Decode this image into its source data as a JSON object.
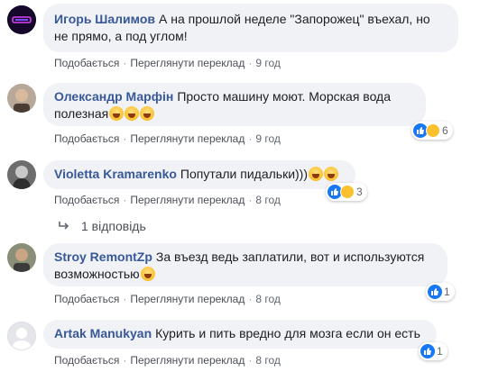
{
  "comments": [
    {
      "author": "Игорь Шалимов",
      "text_line1": "А на прошлой неделе \"Запорожец\" въехал, но",
      "text_line2": "не прямо, а под углом!",
      "like_label": "Подобається",
      "translate_label": "Переглянути переклад",
      "time": "9 год",
      "avatar_icon": "avatar-neon-logo"
    },
    {
      "author": "Олександр Марфін",
      "text_line1": "Просто машину моют. Морская вода",
      "text_line2": "полезная",
      "like_label": "Подобається",
      "translate_label": "Переглянути переклад",
      "time": "9 год",
      "reaction_count": "6",
      "avatar_icon": "avatar-man-photo"
    },
    {
      "author": "Violetta Kramarenko",
      "text_line1": "Попутали пидальки)))",
      "like_label": "Подобається",
      "translate_label": "Переглянути переклад",
      "time": "8 год",
      "reaction_count": "3",
      "avatar_icon": "avatar-woman-photo"
    },
    {
      "author": "Stroy RemontZp",
      "text_line1": "За въезд ведь заплатили, вот и используются",
      "text_line2": "возможностью",
      "like_label": "Подобається",
      "translate_label": "Переглянути переклад",
      "time": "8 год",
      "reaction_count": "1",
      "avatar_icon": "avatar-man-photo"
    },
    {
      "author": "Artak Manukyan",
      "text_line1": "Курить и пить вредно для мозга если он есть",
      "like_label": "Подобається",
      "translate_label": "Переглянути переклад",
      "time": "8 год",
      "reaction_count": "1",
      "avatar_icon": "default-avatar-icon"
    }
  ],
  "replies_label": "1 відповідь",
  "colors": {
    "author": "#385898",
    "bubble": "#f0f2f5",
    "like_blue": "#1877f2"
  }
}
